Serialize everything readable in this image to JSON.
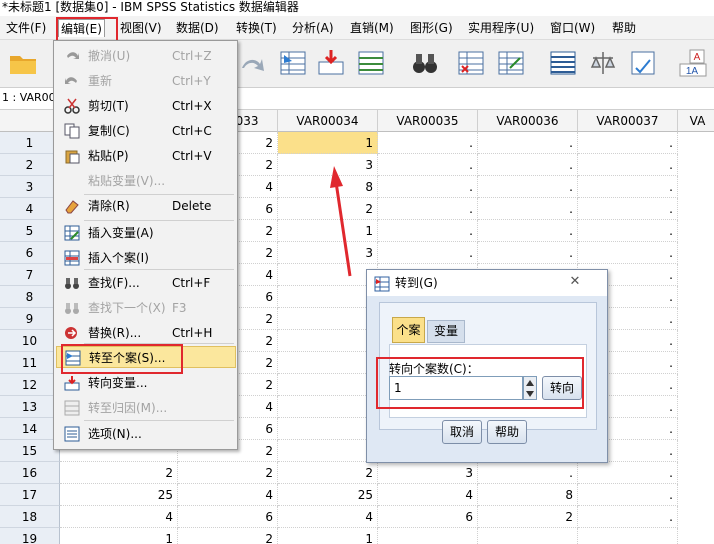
{
  "window": {
    "title": "*未标题1 [数据集0] - IBM SPSS Statistics 数据编辑器"
  },
  "menubar": [
    "文件(F)",
    "编辑(E)",
    "视图(V)",
    "数据(D)",
    "转换(T)",
    "分析(A)",
    "直销(M)",
    "图形(G)",
    "实用程序(U)",
    "窗口(W)",
    "帮助"
  ],
  "cell_ref": "1 : VAR00",
  "columns": [
    "VAR00033",
    "VAR00034",
    "VAR00035",
    "VAR00036",
    "VAR00037",
    "VA"
  ],
  "col_partial": "033",
  "rows": [
    {
      "n": "1",
      "v": [
        "",
        "2",
        "1",
        ".",
        ".",
        "."
      ]
    },
    {
      "n": "2",
      "v": [
        "",
        "2",
        "3",
        ".",
        ".",
        "."
      ]
    },
    {
      "n": "3",
      "v": [
        "",
        "4",
        "8",
        ".",
        ".",
        "."
      ]
    },
    {
      "n": "4",
      "v": [
        "",
        "6",
        "2",
        ".",
        ".",
        "."
      ]
    },
    {
      "n": "5",
      "v": [
        "",
        "2",
        "1",
        ".",
        ".",
        "."
      ]
    },
    {
      "n": "6",
      "v": [
        "",
        "2",
        "3",
        ".",
        ".",
        "."
      ]
    },
    {
      "n": "7",
      "v": [
        "",
        "4",
        "",
        "",
        ".",
        "."
      ]
    },
    {
      "n": "8",
      "v": [
        "",
        "6",
        "",
        "",
        ".",
        "."
      ]
    },
    {
      "n": "9",
      "v": [
        "",
        "2",
        "2",
        "",
        ".",
        "."
      ]
    },
    {
      "n": "10",
      "v": [
        "",
        "2",
        "",
        "",
        ".",
        "."
      ]
    },
    {
      "n": "11",
      "v": [
        "",
        "2",
        "",
        "",
        ".",
        "."
      ]
    },
    {
      "n": "12",
      "v": [
        "",
        "2",
        "2",
        "",
        ".",
        "."
      ]
    },
    {
      "n": "13",
      "v": [
        "",
        "4",
        "",
        "",
        ".",
        "."
      ]
    },
    {
      "n": "14",
      "v": [
        "",
        "6",
        "",
        "",
        ".",
        "."
      ]
    },
    {
      "n": "15",
      "v": [
        "",
        "2",
        "",
        "",
        ".",
        "."
      ]
    },
    {
      "n": "16",
      "v": [
        "2",
        "2",
        "2",
        "3",
        ".",
        "."
      ]
    },
    {
      "n": "17",
      "v": [
        "25",
        "4",
        "25",
        "4",
        "8",
        "."
      ]
    },
    {
      "n": "18",
      "v": [
        "4",
        "6",
        "4",
        "6",
        "2",
        "."
      ]
    },
    {
      "n": "19",
      "v": [
        "1",
        "2",
        "1",
        "",
        "",
        ""
      ]
    }
  ],
  "edit_menu": [
    {
      "label": "撤消(U)",
      "shortcut": "Ctrl+Z",
      "disabled": true,
      "icon": "undo-icon"
    },
    {
      "label": "重新",
      "shortcut": "Ctrl+Y",
      "disabled": true,
      "icon": "redo-icon"
    },
    {
      "label": "剪切(T)",
      "shortcut": "Ctrl+X",
      "disabled": false,
      "icon": "cut-icon"
    },
    {
      "label": "复制(C)",
      "shortcut": "Ctrl+C",
      "disabled": false,
      "icon": "copy-icon"
    },
    {
      "label": "粘贴(P)",
      "shortcut": "Ctrl+V",
      "disabled": false,
      "icon": "paste-icon"
    },
    {
      "label": "粘贴变量(V)...",
      "shortcut": "",
      "disabled": true,
      "icon": ""
    },
    {
      "label": "清除(R)",
      "shortcut": "Delete",
      "disabled": false,
      "icon": "eraser-icon"
    },
    {
      "label": "插入变量(A)",
      "shortcut": "",
      "disabled": false,
      "icon": "insert-variable-icon"
    },
    {
      "label": "插入个案(I)",
      "shortcut": "",
      "disabled": false,
      "icon": "insert-case-icon"
    },
    {
      "label": "查找(F)...",
      "shortcut": "Ctrl+F",
      "disabled": false,
      "icon": "binoculars-icon"
    },
    {
      "label": "查找下一个(X)",
      "shortcut": "F3",
      "disabled": true,
      "icon": "find-next-icon"
    },
    {
      "label": "替换(R)...",
      "shortcut": "Ctrl+H",
      "disabled": false,
      "icon": "replace-icon"
    },
    {
      "label": "转至个案(S)...",
      "shortcut": "",
      "disabled": false,
      "icon": "goto-case-icon"
    },
    {
      "label": "转向变量...",
      "shortcut": "",
      "disabled": false,
      "icon": "goto-variable-icon"
    },
    {
      "label": "转至归因(M)...",
      "shortcut": "",
      "disabled": true,
      "icon": "goto-imputation-icon"
    },
    {
      "label": "选项(N)...",
      "shortcut": "",
      "disabled": false,
      "icon": "options-icon"
    }
  ],
  "dialog": {
    "title": "转到(G)",
    "tabs": [
      "个案",
      "变量"
    ],
    "field_label": "转向个案数(C)：",
    "field_value": "1",
    "go_button": "转向",
    "cancel": "取消",
    "help": "帮助"
  },
  "colors": {
    "accent_red": "#e0282e",
    "selected_cell": "#fbe08a",
    "menu_highlight": "#fbe79d"
  }
}
